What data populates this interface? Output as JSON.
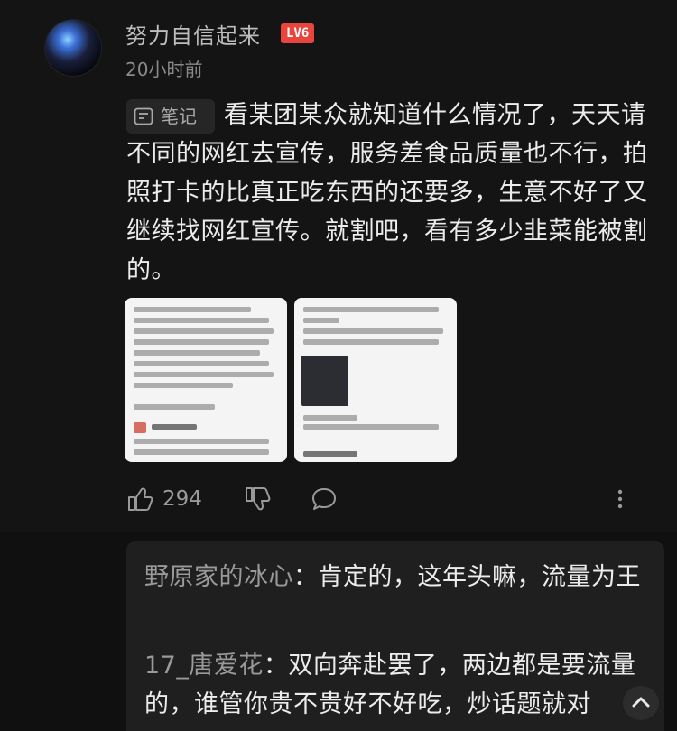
{
  "post": {
    "username": "努力自信起来",
    "level": "LV6",
    "time": "20小时前",
    "note_label": "笔记",
    "content": "看某团某众就知道什么情况了，天天请不同的网红去宣传，服务差食品质量也不行，拍照打卡的比真正吃东西的还要多，生意不好了又继续找网红宣传。就割吧，看有多少韭菜能被割的。",
    "like_count": "294"
  },
  "replies": [
    {
      "name": "野原家的冰心",
      "sep": "：",
      "text": "肯定的，这年头嘛，流量为王"
    },
    {
      "name": "17_唐爱花",
      "sep": "：",
      "text": "双向奔赴罢了，两边都是要流量的，谁管你贵不贵好不好吃，炒话题就对"
    }
  ],
  "colors": {
    "badge": "#e8463c",
    "background": "#141414",
    "reply_bg": "#1f1f1f"
  },
  "icons": [
    "note-icon",
    "thumb-up-icon",
    "thumb-down-icon",
    "comment-icon",
    "more-vertical-icon",
    "scroll-top-icon"
  ]
}
